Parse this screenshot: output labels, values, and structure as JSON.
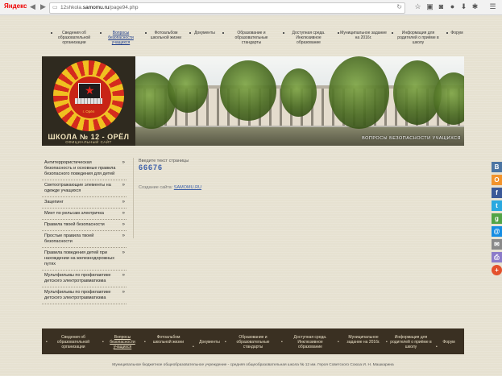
{
  "browser": {
    "logo": "Яндекс",
    "url_prefix": "12shkola.",
    "url_host": "samomu.ru",
    "url_path": "/page94.php",
    "back_icon": "back-arrow-icon",
    "forward_icon": "forward-arrow-icon",
    "reload_icon": "reload-icon"
  },
  "topnav": [
    {
      "label": "Сведения об образовательной организации"
    },
    {
      "label": "Вопросы безопасности учащихся"
    },
    {
      "label": "Фотоальбом школьной жизни"
    },
    {
      "label": "Документы"
    },
    {
      "label": "Образование и образовательные стандарты"
    },
    {
      "label": "Доступная среда. Инклюзивное образование"
    },
    {
      "label": "Муниципальное задание на 2016г."
    },
    {
      "label": "Информация для родителей о приёме в школу"
    },
    {
      "label": "Форум"
    }
  ],
  "header": {
    "school_title": "ШКОЛА № 12 - ОРЁЛ",
    "school_subtitle": "ОФИЦИАЛЬНЫЙ САЙТ",
    "city": "г. Орёл",
    "photo_caption": "Вопросы безопасности учащихся"
  },
  "sidebar": [
    {
      "label": "Антитеррористическая безопасность и основные правила безопасного поведения для детей"
    },
    {
      "label": "Светоотражающие элементы на одежде учащихся"
    },
    {
      "label": "Зацепинг"
    },
    {
      "label": "Минт по рельсам электричка"
    },
    {
      "label": "Правила твоей безопасности"
    },
    {
      "label": "Простые правила твоей безопасности"
    },
    {
      "label": "Правила поведения детей при нахождении на железнодорожных путях"
    },
    {
      "label": "Мультфильмы по профилактике детского электротравматизма"
    },
    {
      "label": "Мультфильмы по профилактике детского электротравматизма"
    }
  ],
  "content": {
    "hint": "Введите текст страницы",
    "number": "66676",
    "created_label": "Создание сайта:",
    "created_link": "SAMOMU.RU"
  },
  "social": [
    {
      "label": "В",
      "icon": "vk-icon",
      "color": "#4c75a3"
    },
    {
      "label": "О",
      "icon": "odnoklassniki-icon",
      "color": "#f2932b"
    },
    {
      "label": "f",
      "icon": "facebook-icon",
      "color": "#3b5998"
    },
    {
      "label": "t",
      "icon": "twitter-icon",
      "color": "#2aa9e0"
    },
    {
      "label": "g",
      "icon": "google-icon",
      "color": "#52a447"
    },
    {
      "label": "@",
      "icon": "mail-icon",
      "color": "#168de2"
    },
    {
      "label": "✉",
      "icon": "email-icon",
      "color": "#8a8a8a"
    },
    {
      "label": "⎙",
      "icon": "print-icon",
      "color": "#8c7bc9"
    },
    {
      "label": "+",
      "icon": "more-icon",
      "color": "#e4512c"
    }
  ],
  "footer": [
    {
      "label": "Сведения об образовательной организации"
    },
    {
      "label": "Вопросы безопасности учащихся"
    },
    {
      "label": "Фотоальбом школьной жизни"
    },
    {
      "label": "Документы"
    },
    {
      "label": "Образование и образовательные стандарты"
    },
    {
      "label": "Доступная среда. Инклюзивное образование"
    },
    {
      "label": "Муниципальное задание на 2016г."
    },
    {
      "label": "Информация для родителей о приёме в школу"
    },
    {
      "label": "Форум"
    }
  ],
  "copyright": "Муниципальное бюджетное общеобразовательное учреждение - средняя общеобразовательная школа № 12 им. Героя Советского Союза И. Н. Машкарина",
  "colors": {
    "page_bg": "#e6e1d1",
    "header_bg": "#3b3426",
    "link": "#3a5ea8"
  }
}
